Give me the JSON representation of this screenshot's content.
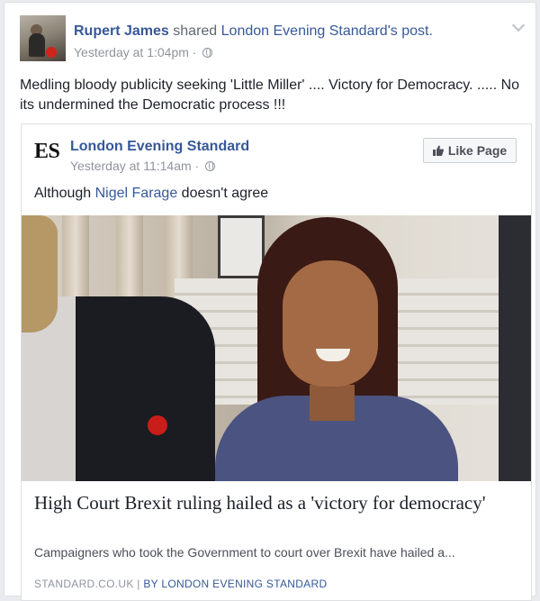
{
  "post": {
    "author_name": "Rupert James",
    "action_text": "shared",
    "shared_from": "London Evening Standard's post.",
    "timestamp": "Yesterday at 1:04pm",
    "separator": "·",
    "text": "Medling bloody publicity seeking 'Little Miller' .... Victory for Democracy. ..... No its undermined the Democratic process !!!"
  },
  "shared_post": {
    "logo_text": "ES",
    "page_name": "London Evening Standard",
    "timestamp": "Yesterday at 11:14am",
    "separator": "·",
    "like_button_label": "Like Page",
    "text_before": "Although ",
    "mention": "Nigel Farage",
    "text_after": " doesn't agree"
  },
  "link_preview": {
    "headline": "High Court Brexit ruling hailed as a 'victory for democracy'",
    "summary": "Campaigners who took the Government to court over Brexit have hailed a...",
    "domain": "STANDARD.CO.UK",
    "divider": "|",
    "byline": "BY LONDON EVENING STANDARD"
  },
  "icons": {
    "audience": "globe-icon",
    "menu": "chevron-down-icon",
    "like": "thumbs-up-icon"
  },
  "colors": {
    "link": "#365899",
    "muted": "#90949c",
    "background": "#e9ebee"
  }
}
